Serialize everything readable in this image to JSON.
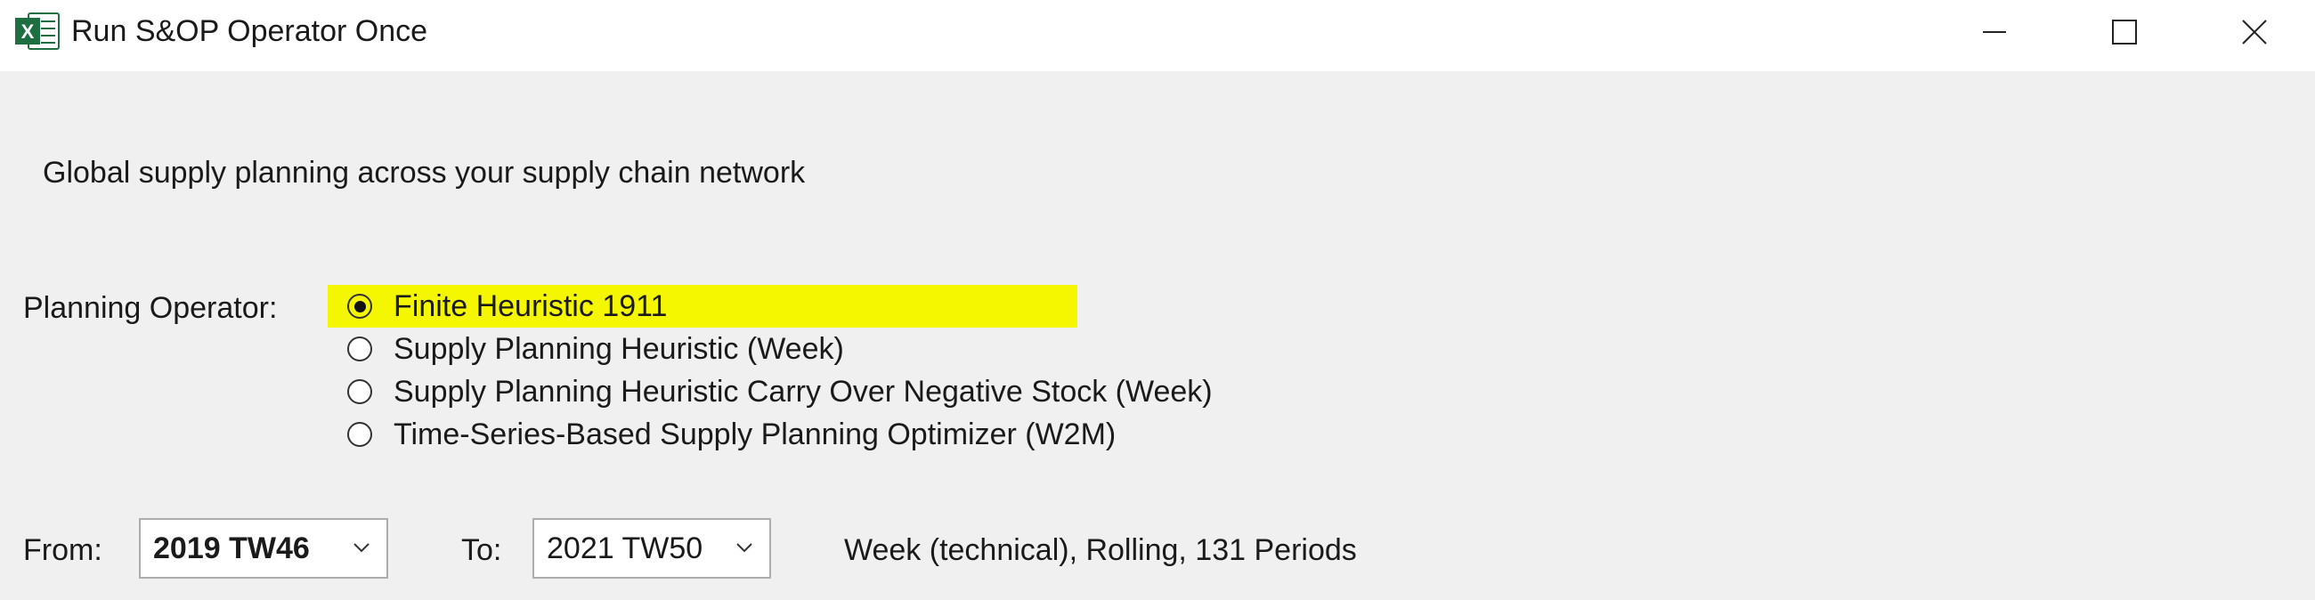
{
  "window": {
    "title": "Run S&OP Operator Once",
    "app_icon": "excel-icon",
    "app_icon_letter": "X",
    "accent": "#1d6f42",
    "controls": [
      "minimize-icon",
      "maximize-icon",
      "close-icon"
    ]
  },
  "description": "Global supply planning across your supply chain network",
  "planning": {
    "label": "Planning Operator:",
    "highlight_color": "#f5f700",
    "options": [
      {
        "label": "Finite Heuristic 1911",
        "selected": true
      },
      {
        "label": "Supply Planning Heuristic (Week)",
        "selected": false
      },
      {
        "label": "Supply Planning Heuristic Carry Over Negative Stock (Week)",
        "selected": false
      },
      {
        "label": "Time-Series-Based Supply Planning Optimizer (W2M)",
        "selected": false
      }
    ]
  },
  "period": {
    "from_label": "From:",
    "from_value": "2019 TW46",
    "to_label": "To:",
    "to_value": "2021 TW50",
    "info": "Week (technical), Rolling, 131 Periods"
  }
}
